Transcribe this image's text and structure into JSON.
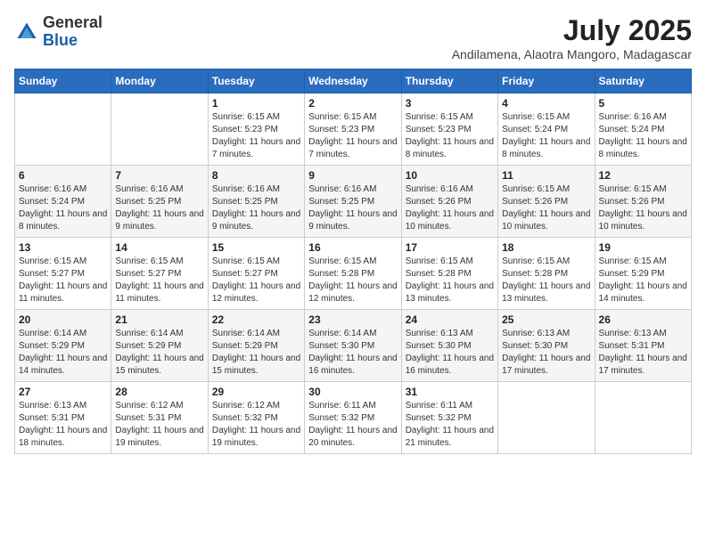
{
  "header": {
    "logo_line1": "General",
    "logo_line2": "Blue",
    "month_year": "July 2025",
    "location": "Andilamena, Alaotra Mangoro, Madagascar"
  },
  "weekdays": [
    "Sunday",
    "Monday",
    "Tuesday",
    "Wednesday",
    "Thursday",
    "Friday",
    "Saturday"
  ],
  "weeks": [
    [
      {
        "day": "",
        "sunrise": "",
        "sunset": "",
        "daylight": ""
      },
      {
        "day": "",
        "sunrise": "",
        "sunset": "",
        "daylight": ""
      },
      {
        "day": "1",
        "sunrise": "Sunrise: 6:15 AM",
        "sunset": "Sunset: 5:23 PM",
        "daylight": "Daylight: 11 hours and 7 minutes."
      },
      {
        "day": "2",
        "sunrise": "Sunrise: 6:15 AM",
        "sunset": "Sunset: 5:23 PM",
        "daylight": "Daylight: 11 hours and 7 minutes."
      },
      {
        "day": "3",
        "sunrise": "Sunrise: 6:15 AM",
        "sunset": "Sunset: 5:23 PM",
        "daylight": "Daylight: 11 hours and 8 minutes."
      },
      {
        "day": "4",
        "sunrise": "Sunrise: 6:15 AM",
        "sunset": "Sunset: 5:24 PM",
        "daylight": "Daylight: 11 hours and 8 minutes."
      },
      {
        "day": "5",
        "sunrise": "Sunrise: 6:16 AM",
        "sunset": "Sunset: 5:24 PM",
        "daylight": "Daylight: 11 hours and 8 minutes."
      }
    ],
    [
      {
        "day": "6",
        "sunrise": "Sunrise: 6:16 AM",
        "sunset": "Sunset: 5:24 PM",
        "daylight": "Daylight: 11 hours and 8 minutes."
      },
      {
        "day": "7",
        "sunrise": "Sunrise: 6:16 AM",
        "sunset": "Sunset: 5:25 PM",
        "daylight": "Daylight: 11 hours and 9 minutes."
      },
      {
        "day": "8",
        "sunrise": "Sunrise: 6:16 AM",
        "sunset": "Sunset: 5:25 PM",
        "daylight": "Daylight: 11 hours and 9 minutes."
      },
      {
        "day": "9",
        "sunrise": "Sunrise: 6:16 AM",
        "sunset": "Sunset: 5:25 PM",
        "daylight": "Daylight: 11 hours and 9 minutes."
      },
      {
        "day": "10",
        "sunrise": "Sunrise: 6:16 AM",
        "sunset": "Sunset: 5:26 PM",
        "daylight": "Daylight: 11 hours and 10 minutes."
      },
      {
        "day": "11",
        "sunrise": "Sunrise: 6:15 AM",
        "sunset": "Sunset: 5:26 PM",
        "daylight": "Daylight: 11 hours and 10 minutes."
      },
      {
        "day": "12",
        "sunrise": "Sunrise: 6:15 AM",
        "sunset": "Sunset: 5:26 PM",
        "daylight": "Daylight: 11 hours and 10 minutes."
      }
    ],
    [
      {
        "day": "13",
        "sunrise": "Sunrise: 6:15 AM",
        "sunset": "Sunset: 5:27 PM",
        "daylight": "Daylight: 11 hours and 11 minutes."
      },
      {
        "day": "14",
        "sunrise": "Sunrise: 6:15 AM",
        "sunset": "Sunset: 5:27 PM",
        "daylight": "Daylight: 11 hours and 11 minutes."
      },
      {
        "day": "15",
        "sunrise": "Sunrise: 6:15 AM",
        "sunset": "Sunset: 5:27 PM",
        "daylight": "Daylight: 11 hours and 12 minutes."
      },
      {
        "day": "16",
        "sunrise": "Sunrise: 6:15 AM",
        "sunset": "Sunset: 5:28 PM",
        "daylight": "Daylight: 11 hours and 12 minutes."
      },
      {
        "day": "17",
        "sunrise": "Sunrise: 6:15 AM",
        "sunset": "Sunset: 5:28 PM",
        "daylight": "Daylight: 11 hours and 13 minutes."
      },
      {
        "day": "18",
        "sunrise": "Sunrise: 6:15 AM",
        "sunset": "Sunset: 5:28 PM",
        "daylight": "Daylight: 11 hours and 13 minutes."
      },
      {
        "day": "19",
        "sunrise": "Sunrise: 6:15 AM",
        "sunset": "Sunset: 5:29 PM",
        "daylight": "Daylight: 11 hours and 14 minutes."
      }
    ],
    [
      {
        "day": "20",
        "sunrise": "Sunrise: 6:14 AM",
        "sunset": "Sunset: 5:29 PM",
        "daylight": "Daylight: 11 hours and 14 minutes."
      },
      {
        "day": "21",
        "sunrise": "Sunrise: 6:14 AM",
        "sunset": "Sunset: 5:29 PM",
        "daylight": "Daylight: 11 hours and 15 minutes."
      },
      {
        "day": "22",
        "sunrise": "Sunrise: 6:14 AM",
        "sunset": "Sunset: 5:29 PM",
        "daylight": "Daylight: 11 hours and 15 minutes."
      },
      {
        "day": "23",
        "sunrise": "Sunrise: 6:14 AM",
        "sunset": "Sunset: 5:30 PM",
        "daylight": "Daylight: 11 hours and 16 minutes."
      },
      {
        "day": "24",
        "sunrise": "Sunrise: 6:13 AM",
        "sunset": "Sunset: 5:30 PM",
        "daylight": "Daylight: 11 hours and 16 minutes."
      },
      {
        "day": "25",
        "sunrise": "Sunrise: 6:13 AM",
        "sunset": "Sunset: 5:30 PM",
        "daylight": "Daylight: 11 hours and 17 minutes."
      },
      {
        "day": "26",
        "sunrise": "Sunrise: 6:13 AM",
        "sunset": "Sunset: 5:31 PM",
        "daylight": "Daylight: 11 hours and 17 minutes."
      }
    ],
    [
      {
        "day": "27",
        "sunrise": "Sunrise: 6:13 AM",
        "sunset": "Sunset: 5:31 PM",
        "daylight": "Daylight: 11 hours and 18 minutes."
      },
      {
        "day": "28",
        "sunrise": "Sunrise: 6:12 AM",
        "sunset": "Sunset: 5:31 PM",
        "daylight": "Daylight: 11 hours and 19 minutes."
      },
      {
        "day": "29",
        "sunrise": "Sunrise: 6:12 AM",
        "sunset": "Sunset: 5:32 PM",
        "daylight": "Daylight: 11 hours and 19 minutes."
      },
      {
        "day": "30",
        "sunrise": "Sunrise: 6:11 AM",
        "sunset": "Sunset: 5:32 PM",
        "daylight": "Daylight: 11 hours and 20 minutes."
      },
      {
        "day": "31",
        "sunrise": "Sunrise: 6:11 AM",
        "sunset": "Sunset: 5:32 PM",
        "daylight": "Daylight: 11 hours and 21 minutes."
      },
      {
        "day": "",
        "sunrise": "",
        "sunset": "",
        "daylight": ""
      },
      {
        "day": "",
        "sunrise": "",
        "sunset": "",
        "daylight": ""
      }
    ]
  ]
}
